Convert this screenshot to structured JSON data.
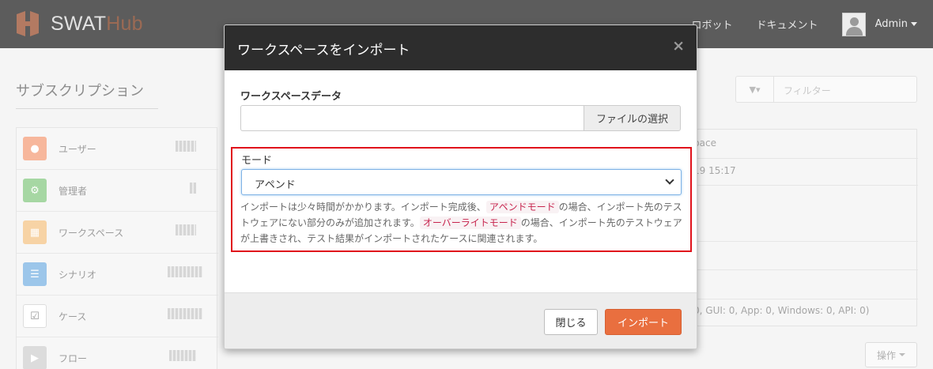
{
  "navbar": {
    "brand_main": "SWAT",
    "brand_accent": "Hub",
    "links": [
      "ロボット",
      "ドキュメント"
    ],
    "user": "Admin"
  },
  "page": {
    "title": "サブスクリプション",
    "sidebar": [
      {
        "label": "ユーザー",
        "icon": "users-icon",
        "color": "#f4a07d"
      },
      {
        "label": "管理者",
        "icon": "cogs-icon",
        "color": "#86c882"
      },
      {
        "label": "ワークスペース",
        "icon": "grid-icon",
        "color": "#f5c589"
      },
      {
        "label": "シナリオ",
        "icon": "list-icon",
        "color": "#6aa9dc"
      },
      {
        "label": "ケース",
        "icon": "checkbox-icon",
        "color": "#ffffff"
      },
      {
        "label": "フロー",
        "icon": "play-icon",
        "color": "#cfcfcf"
      }
    ],
    "filter_placeholder": "フィルター",
    "table_header_fragment": "pace",
    "table_date_fragment": "19 15:17",
    "table_summary_fragment": "0, GUI: 0, App: 0, Windows: 0, API: 0)",
    "ops_label": "操作"
  },
  "modal": {
    "title": "ワークスペースをインポート",
    "close_symbol": "×",
    "workspace_data_label": "ワークスペースデータ",
    "file_button": "ファイルの選択",
    "mode_label": "モード",
    "mode_value": "アペンド",
    "help_part1": "インポートは少々時間がかかります。インポート完成後、",
    "help_code1": "アペンドモード",
    "help_part2": "の場合、インポート先のテストウェアにない部分のみが追加されます。",
    "help_code2": "オーバーライトモード",
    "help_part3": "の場合、インポート先のテストウェアが上書きされ、テスト結果がインポートされたケースに関連されます。",
    "close_button": "閉じる",
    "import_button": "インポート"
  }
}
